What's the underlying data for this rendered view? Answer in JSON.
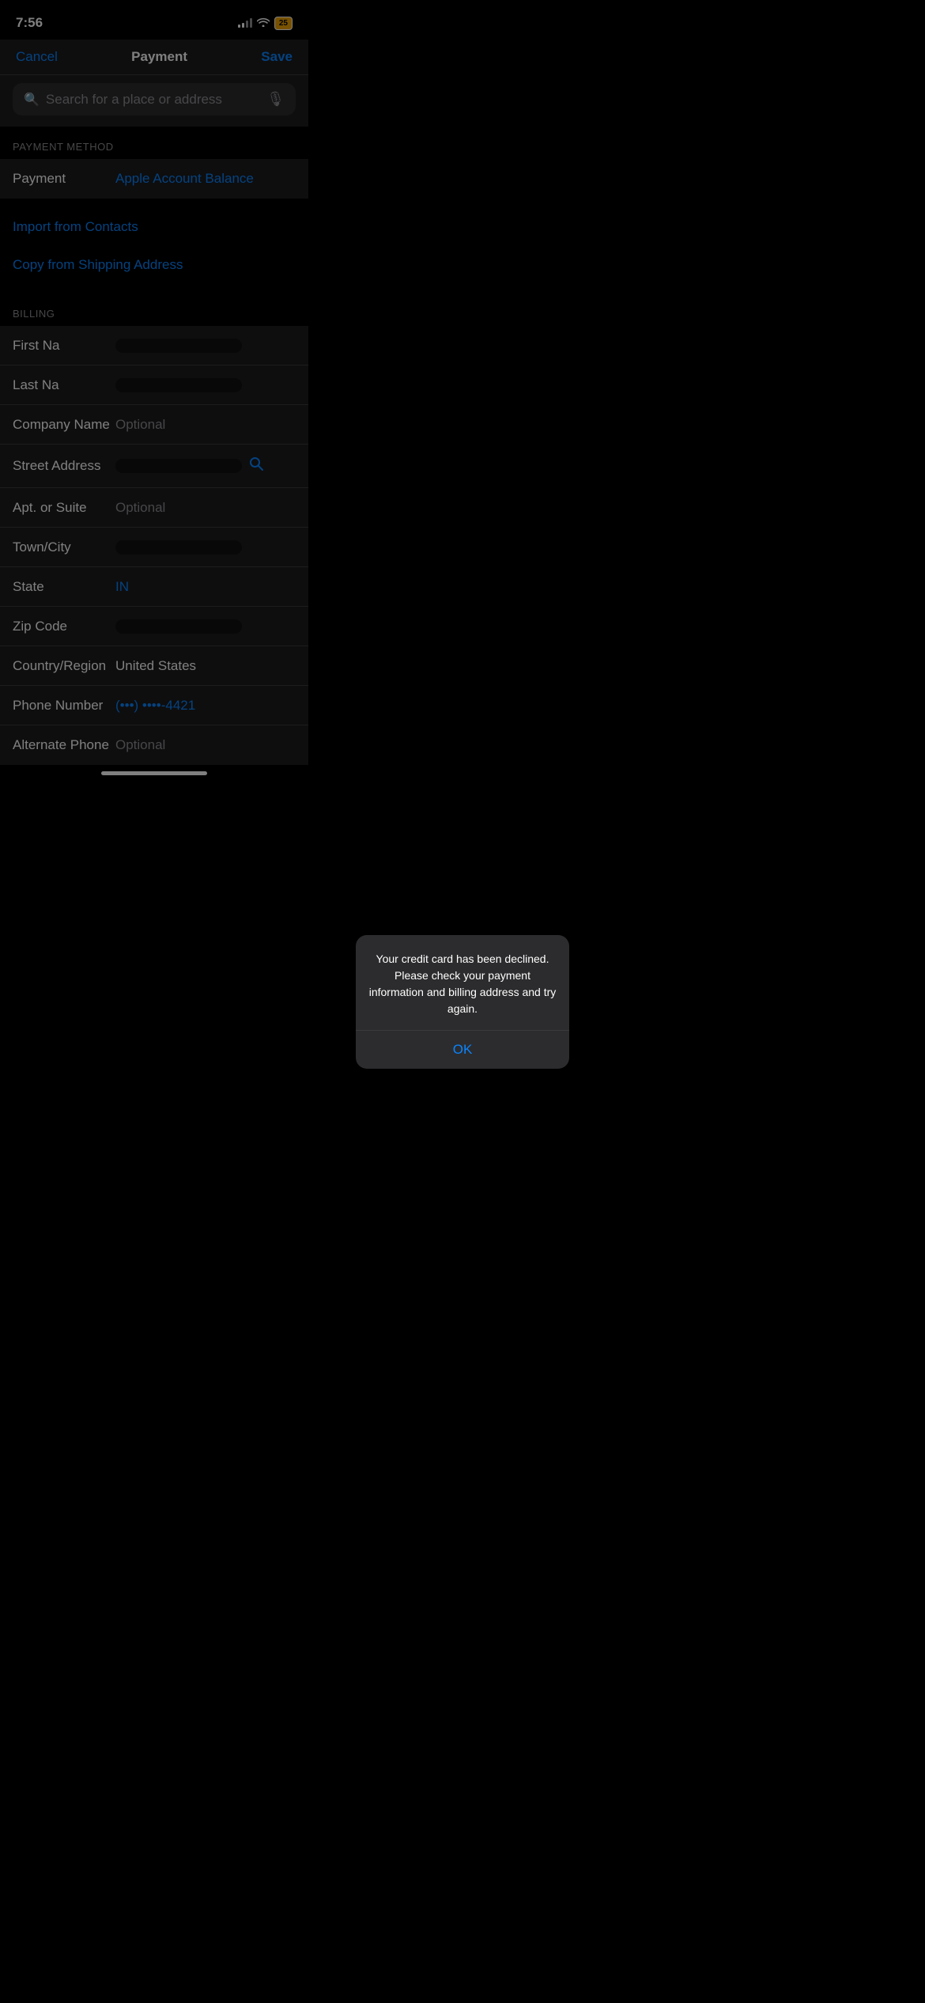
{
  "statusBar": {
    "time": "7:56",
    "battery": "25"
  },
  "navBar": {
    "cancelLabel": "Cancel",
    "title": "Payment",
    "saveLabel": "Save"
  },
  "searchBar": {
    "placeholder": "Search for a place or address"
  },
  "paymentMethod": {
    "sectionHeader": "PAYMENT METHOD",
    "label": "Payment",
    "value": "Apple Account Balance"
  },
  "actionLinks": {
    "importContacts": "Import from Contacts",
    "copyShipping": "Copy from Shipping Address"
  },
  "billingSection": {
    "sectionHeader": "BILLING",
    "fields": [
      {
        "label": "First Na",
        "value": "",
        "type": "redacted"
      },
      {
        "label": "Last Na",
        "value": "",
        "type": "redacted"
      },
      {
        "label": "Company Name",
        "value": "Optional",
        "type": "placeholder"
      },
      {
        "label": "Street Address",
        "value": "",
        "type": "redacted",
        "hasSearchIcon": true
      },
      {
        "label": "Apt. or Suite",
        "value": "Optional",
        "type": "placeholder"
      },
      {
        "label": "Town/City",
        "value": "",
        "type": "redacted"
      },
      {
        "label": "State",
        "value": "IN",
        "type": "blue"
      },
      {
        "label": "Zip Code",
        "value": "",
        "type": "redacted"
      },
      {
        "label": "Country/Region",
        "value": "United States",
        "type": "white"
      },
      {
        "label": "Phone Number",
        "value": "(•••) ••••-4421",
        "type": "blue"
      },
      {
        "label": "Alternate Phone",
        "value": "Optional",
        "type": "placeholder"
      }
    ]
  },
  "alertDialog": {
    "message": "Your credit card has been declined. Please check your payment information and billing address and try again.",
    "buttonLabel": "OK"
  }
}
